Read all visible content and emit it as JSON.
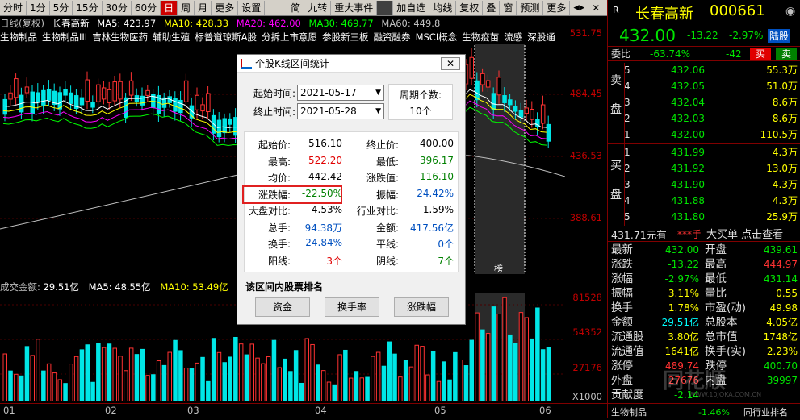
{
  "toolbar": {
    "periods": [
      "分时",
      "1分",
      "5分",
      "15分",
      "30分",
      "60分",
      "日",
      "周",
      "月",
      "更多",
      "设置"
    ],
    "active_period": "日",
    "tools": [
      "简",
      "九转",
      "重大事件",
      "",
      "加自选",
      "均线",
      "复权",
      "叠",
      "窗",
      "预测",
      "更多"
    ]
  },
  "ma_line": {
    "chart_name": "日线(复权)",
    "stock": "长春高新",
    "ma5": "MA5: 423.97",
    "ma10": "MA10: 428.33",
    "ma20": "MA20: 462.00",
    "ma30": "MA30: 469.77",
    "ma60": "MA60: 449.8"
  },
  "concepts": [
    "生物制品",
    "生物制品III",
    "吉林生物医药",
    "辅助生殖",
    "标普道琼斯A股",
    "分拆上市意愿",
    "参股新三板",
    "融资融券",
    "MSCI概念",
    "生物疫苗",
    "流感",
    "深股通"
  ],
  "k_axis": {
    "ticks": [
      "531.75",
      "484.45",
      "436.53",
      "388.61"
    ]
  },
  "vol_line": {
    "label": "成交金额:",
    "value": "29.51亿",
    "ma5": "MA5: 48.55亿",
    "ma10": "MA10: 53.49亿"
  },
  "vol_axis": {
    "ticks": [
      "81528",
      "54352",
      "27176"
    ],
    "unit": "X1000"
  },
  "x_axis": {
    "ticks": [
      "01",
      "02",
      "03",
      "04",
      "05",
      "06"
    ]
  },
  "chart_marks": {
    "high_label": "522.20",
    "bang": "榜"
  },
  "colors": {
    "up": "#ff3232",
    "down": "#00e6e6",
    "bg": "#000000",
    "ma5": "#ffffff",
    "ma10": "#ffff00",
    "ma20": "#ff00ff",
    "ma30": "#00ff00",
    "ma60": "#c0c0c0"
  },
  "dialog": {
    "title": "个股K线区间统计",
    "start_label": "起始时间:",
    "start_value": "2021-05-17",
    "end_label": "终止时间:",
    "end_value": "2021-05-28",
    "period_label": "周期个数:",
    "period_value": "10个",
    "stats": [
      {
        "l1": "起始价:",
        "v1": "516.10",
        "c1": "#000",
        "l2": "终止价:",
        "v2": "400.00",
        "c2": "#000"
      },
      {
        "l1": "最高:",
        "v1": "522.20",
        "c1": "#e00000",
        "l2": "最低:",
        "v2": "396.17",
        "c2": "#008000"
      },
      {
        "l1": "均价:",
        "v1": "442.42",
        "c1": "#000",
        "l2": "涨跌值:",
        "v2": "-116.10",
        "c2": "#008000"
      },
      {
        "l1": "涨跌幅:",
        "v1": "-22.50%",
        "c1": "#008000",
        "l2": "振幅:",
        "v2": "24.42%",
        "c2": "#0050c0"
      },
      {
        "l1": "大盘对比:",
        "v1": "4.53%",
        "c1": "#000",
        "l2": "行业对比:",
        "v2": "1.59%",
        "c2": "#000"
      },
      {
        "l1": "总手:",
        "v1": "94.38万",
        "c1": "#0050c0",
        "l2": "金额:",
        "v2": "417.56亿",
        "c2": "#0050c0"
      },
      {
        "l1": "换手:",
        "v1": "24.84%",
        "c1": "#0050c0",
        "l2": "平线:",
        "v2": "0个",
        "c2": "#0050c0"
      },
      {
        "l1": "阳线:",
        "v1": "3个",
        "c1": "#e00000",
        "l2": "阴线:",
        "v2": "7个",
        "c2": "#008000"
      }
    ],
    "rank_title": "该区间内股票排名",
    "btn_capital": "资金",
    "btn_turnover": "换手率",
    "btn_change": "涨跌幅"
  },
  "quote": {
    "badge": "R",
    "name": "长春高新",
    "code": "000661",
    "price": "432.00",
    "change": "-13.22",
    "pct": "-2.97%",
    "board": "陆股",
    "weibi_label": "委比",
    "weibi_value": "-63.74%",
    "weicha": "-42",
    "buy_btn": "买",
    "sell_btn": "卖",
    "sell_side": "卖盘",
    "buy_side": "买盘",
    "asks": [
      {
        "lv": "5",
        "price": "432.06",
        "vol": "55.3万"
      },
      {
        "lv": "4",
        "price": "432.05",
        "vol": "51.0万"
      },
      {
        "lv": "3",
        "price": "432.04",
        "vol": "8.6万"
      },
      {
        "lv": "2",
        "price": "432.03",
        "vol": "8.6万"
      },
      {
        "lv": "1",
        "price": "432.00",
        "vol": "110.5万"
      }
    ],
    "bids": [
      {
        "lv": "1",
        "price": "431.99",
        "vol": "4.3万"
      },
      {
        "lv": "2",
        "price": "431.92",
        "vol": "13.0万"
      },
      {
        "lv": "3",
        "price": "431.90",
        "vol": "4.3万"
      },
      {
        "lv": "4",
        "price": "431.88",
        "vol": "4.3万"
      },
      {
        "lv": "5",
        "price": "431.80",
        "vol": "25.9万"
      }
    ],
    "bigorder": "431.71元有",
    "bigorder2": "***手",
    "bigorder3": "大买单 点击查看",
    "details": [
      {
        "l1": "最新",
        "v1": "432.00",
        "c1": "#00e600",
        "l2": "开盘",
        "v2": "439.61",
        "c2": "#00e600"
      },
      {
        "l1": "涨跌",
        "v1": "-13.22",
        "c1": "#00e600",
        "l2": "最高",
        "v2": "444.97",
        "c2": "#ff3232"
      },
      {
        "l1": "涨幅",
        "v1": "-2.97%",
        "c1": "#00e600",
        "l2": "最低",
        "v2": "431.14",
        "c2": "#00e600"
      },
      {
        "l1": "振幅",
        "v1": "3.11%",
        "c1": "#ffff00",
        "l2": "量比",
        "v2": "0.55",
        "c2": "#ffff00"
      },
      {
        "l1": "换手",
        "v1": "1.78%",
        "c1": "#ffff00",
        "l2": "市盈(动)",
        "v2": "49.98",
        "c2": "#ffff00"
      },
      {
        "l1": "金额",
        "v1": "29.51亿",
        "c1": "#00ffff",
        "l2": "总股本",
        "v2": "4.05亿",
        "c2": "#ffff00"
      },
      {
        "l1": "流通股",
        "v1": "3.80亿",
        "c1": "#ffff00",
        "l2": "总市值",
        "v2": "1748亿",
        "c2": "#ffff00"
      },
      {
        "l1": "流通值",
        "v1": "1641亿",
        "c1": "#ffff00",
        "l2": "换手(实)",
        "v2": "2.23%",
        "c2": "#ffff00"
      },
      {
        "l1": "涨停",
        "v1": "489.74",
        "c1": "#ff3232",
        "l2": "跌停",
        "v2": "400.70",
        "c2": "#00e600"
      },
      {
        "l1": "外盘",
        "v1": "27676",
        "c1": "#ff3232",
        "l2": "内盘",
        "v2": "39997",
        "c2": "#00e600"
      },
      {
        "l1": "贡献度",
        "v1": "-2.14",
        "c1": "#00e600",
        "l2": "",
        "v2": "",
        "c2": "#000"
      }
    ],
    "footer_industry": "生物制品",
    "footer_pct": "-1.46%",
    "footer_rank": "同行业排名",
    "watermark": "同花顺",
    "watermark_url": "WWW.10JQKA.COM.CN"
  }
}
